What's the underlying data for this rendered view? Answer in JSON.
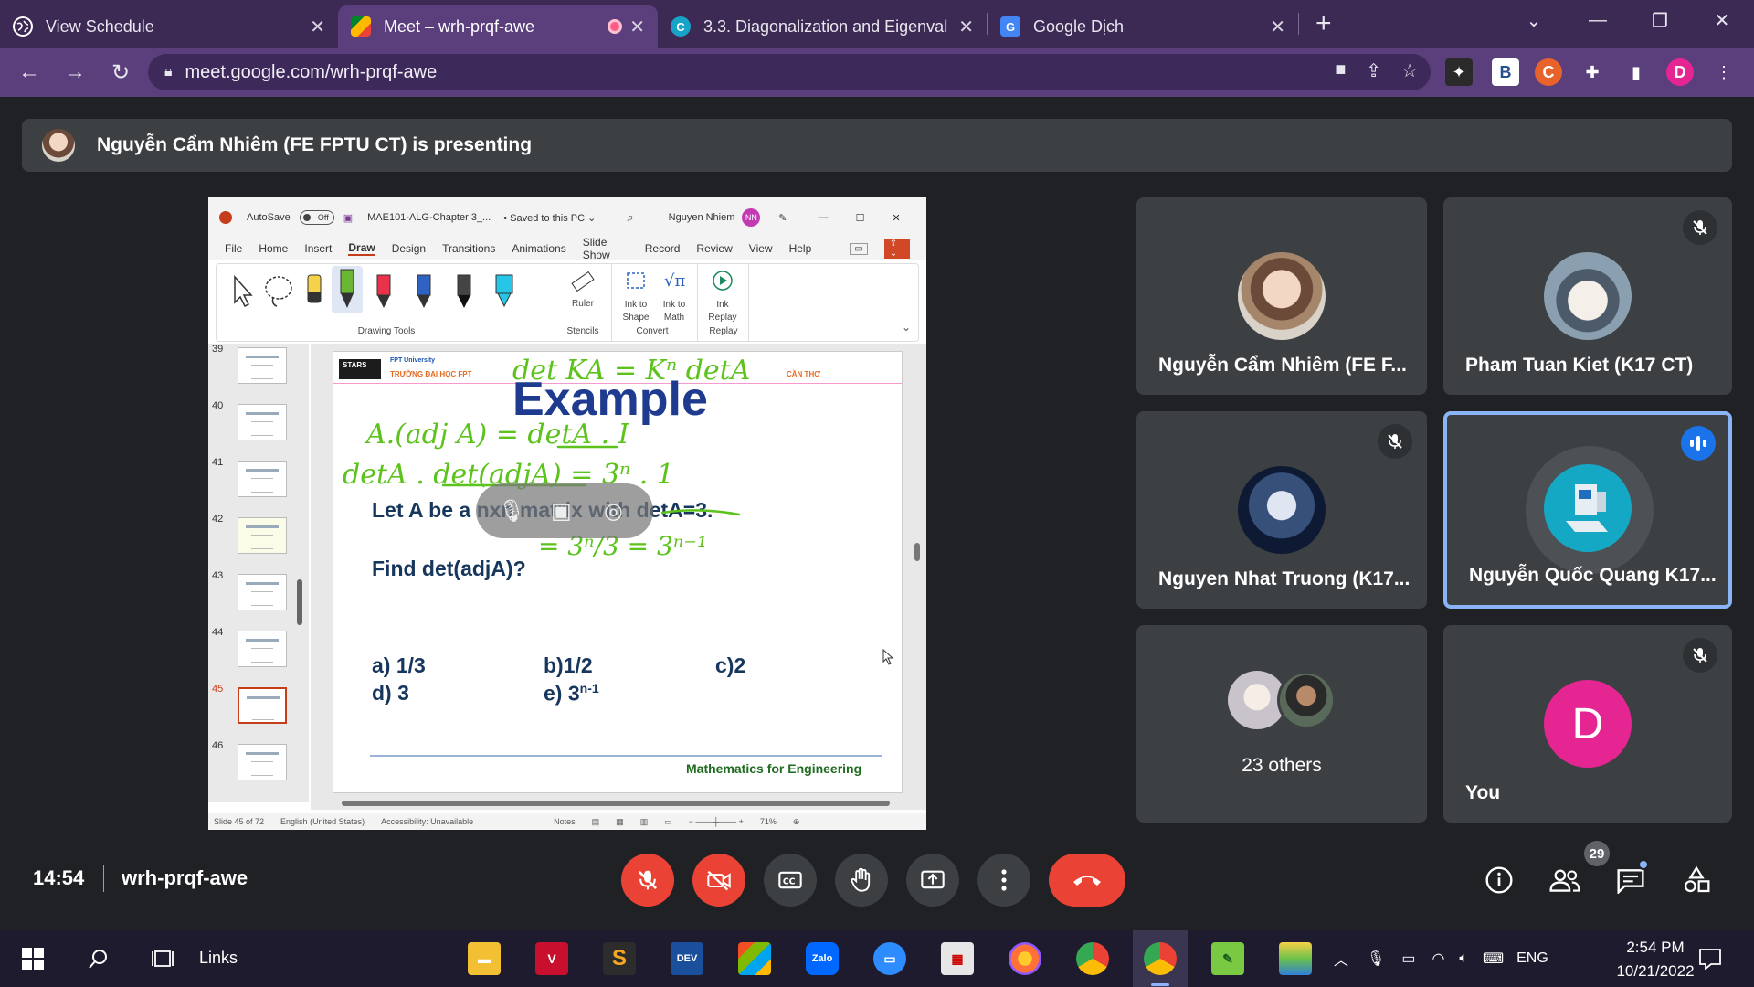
{
  "browser": {
    "tabs": [
      {
        "title": "View Schedule",
        "active": false
      },
      {
        "title": "Meet – wrh-prqf-awe",
        "active": true,
        "recording": true
      },
      {
        "title": "3.3. Diagonalization and Eigenval",
        "active": false
      },
      {
        "title": "Google Dịch",
        "active": false
      }
    ],
    "url": "meet.google.com/wrh-prqf-awe",
    "profile_initial": "D",
    "ext_b": "B",
    "ext_c": "C"
  },
  "meet": {
    "presenting_text": "Nguyễn Cẩm Nhiêm (FE FPTU CT) is presenting",
    "time": "14:54",
    "meeting_code": "wrh-prqf-awe",
    "participant_count": "29",
    "participants": [
      {
        "name": "Nguyễn Cẩm Nhiêm (FE F...",
        "muted": false
      },
      {
        "name": "Pham Tuan Kiet (K17 CT)",
        "muted": true
      },
      {
        "name": "Nguyen Nhat Truong (K17...",
        "muted": true
      },
      {
        "name": "Nguyễn Quốc Quang K17...",
        "muted": false,
        "speaking": true
      },
      {
        "name": "23 others"
      },
      {
        "name": "You",
        "muted": true,
        "initial": "D",
        "avatar_color": "#e52592"
      }
    ],
    "colors": {
      "leave": "#ea4335",
      "speaking_border": "#8ab4f8",
      "accent": "#1a73e8"
    }
  },
  "powerpoint": {
    "autosave": "AutoSave",
    "toggle": "Off",
    "filename": "MAE101-ALG-Chapter 3_...",
    "saved": "• Saved to this PC ⌄",
    "user": "Nguyen Nhiem",
    "user_initials": "NN",
    "menu": [
      "File",
      "Home",
      "Insert",
      "Draw",
      "Design",
      "Transitions",
      "Animations",
      "Slide Show",
      "Record",
      "Review",
      "View",
      "Help"
    ],
    "active_menu": "Draw",
    "ribbon_groups": {
      "drawing_tools": "Drawing Tools",
      "stencils": "Stencils",
      "convert": "Convert",
      "replay": "Replay"
    },
    "ribbon_buttons": {
      "ruler": "Ruler",
      "ink_to_shape": "Ink to Shape",
      "ink_to_math": "Ink to Math",
      "ink_replay": "Ink Replay"
    },
    "thumbnails": [
      "39",
      "40",
      "41",
      "42",
      "43",
      "44",
      "45",
      "46"
    ],
    "selected_slide": "45",
    "status": {
      "slide": "Slide 45 of 72",
      "language": "English (United States)",
      "accessibility": "Accessibility: Unavailable",
      "notes": "Notes",
      "zoom": "71%"
    },
    "slide": {
      "stars": "STARS",
      "fpt": "FPT University",
      "school": "TRƯỜNG ĐẠI HỌC FPT",
      "school_right": "CẦN THƠ",
      "title": "Example",
      "question1": "Let A be a nxn matrix with detA=3.",
      "question2": "Find det(adjA)?",
      "answers": {
        "a": "a)  1/3",
        "b": "b)1/2",
        "c": "c)2",
        "d": "d) 3",
        "e": "e) 3",
        "e_sup": "n-1"
      },
      "footer": "Mathematics for Engineering",
      "ink": {
        "line1": "det KA = K^n detA",
        "line2": "A.(adj A) = detA . I",
        "line3": "detA . det(adjA) = 3^n . 1",
        "line4": "= 3^n / 3 = 3^(n-1)"
      }
    }
  },
  "taskbar": {
    "links": "Links",
    "lang": "ENG",
    "time": "2:54 PM",
    "date": "10/21/2022"
  }
}
